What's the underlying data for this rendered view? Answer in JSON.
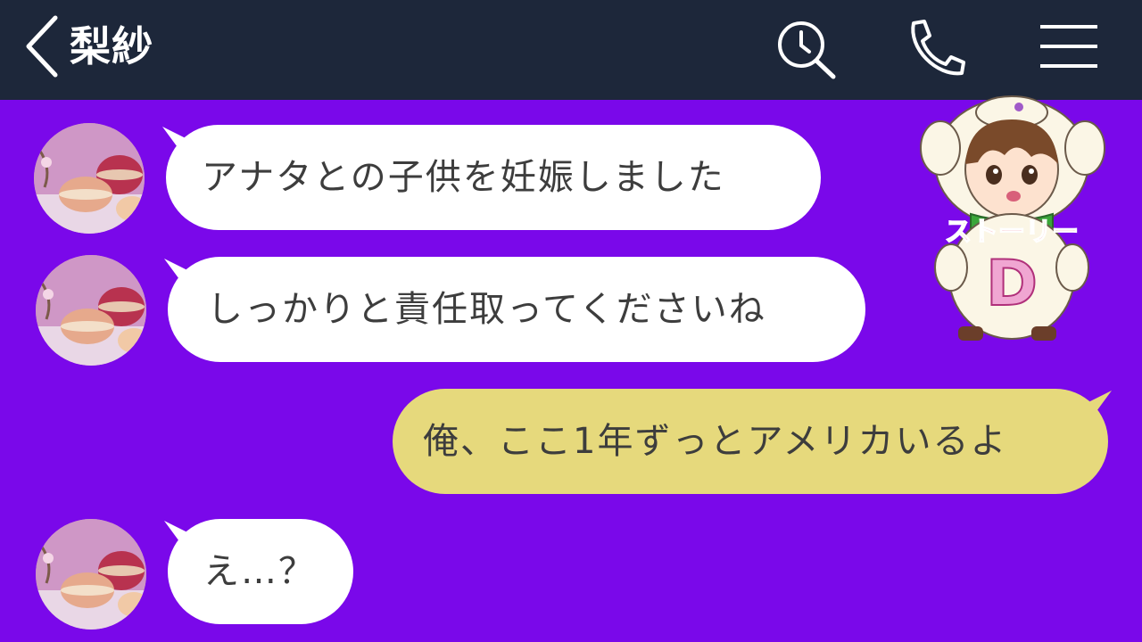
{
  "header": {
    "contact_name": "梨紗",
    "icons": [
      "back-chevron-icon",
      "search-clock-icon",
      "phone-icon",
      "menu-icon"
    ],
    "background": "#1d273a"
  },
  "chat": {
    "background": "#7a08ea",
    "incoming_bubble_color": "#ffffff",
    "outgoing_bubble_color": "#e6d97c",
    "messages": [
      {
        "side": "incoming",
        "text": "アナタとの子供を妊娠しました"
      },
      {
        "side": "incoming",
        "text": "しっかりと責任取ってくださいね"
      },
      {
        "side": "outgoing",
        "text": "俺、ここ1年ずっとアメリカいるよ"
      },
      {
        "side": "incoming",
        "text": "え…？"
      }
    ]
  },
  "mascot": {
    "sign_text": "ストーリー",
    "letter": "D"
  }
}
